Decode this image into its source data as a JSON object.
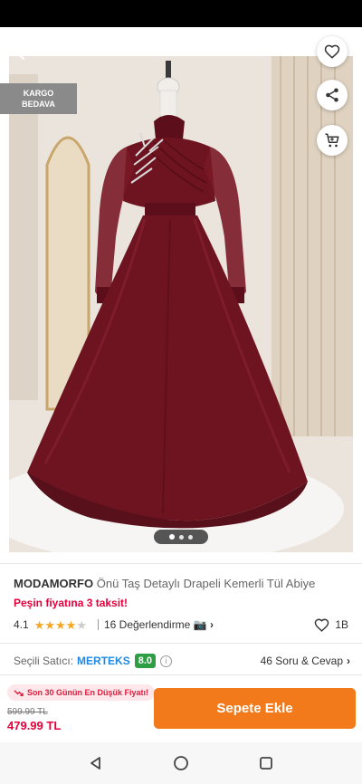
{
  "hero": {
    "kargo_line1": "KARGO",
    "kargo_line2": "BEDAVA",
    "image_count": 3,
    "active_image": 1
  },
  "product": {
    "brand": "MODAMORFO",
    "name": "Önü Taş Detaylı Drapeli Kemerli Tül Abiye",
    "installment": "Peşin fiyatına 3 taksit!",
    "rating": "4.1",
    "rating_value": 4.1,
    "reviews": "16 Değerlendirme",
    "favorites": "1B"
  },
  "seller": {
    "label": "Seçili Satıcı:",
    "name": "MERTEKS",
    "score": "8.0",
    "qa": "46 Soru & Cevap"
  },
  "bottom": {
    "badge": "Son 30 Günün En Düşük Fiyatı!",
    "old_price": "599.99 TL",
    "new_price": "479.99 TL",
    "add_to_cart": "Sepete Ekle"
  },
  "colors": {
    "accent": "#f27a1a",
    "price": "#e4003a",
    "seller": "#1e88e5",
    "score": "#2e9e44",
    "star": "#f5a623",
    "dress": "#6e1420"
  },
  "icons": [
    "back-arrow-icon",
    "heart-icon",
    "share-icon",
    "cart-icon",
    "camera-icon",
    "chevron-right-icon",
    "info-icon",
    "trend-down-icon",
    "nav-back-icon",
    "nav-home-icon",
    "nav-recents-icon"
  ]
}
